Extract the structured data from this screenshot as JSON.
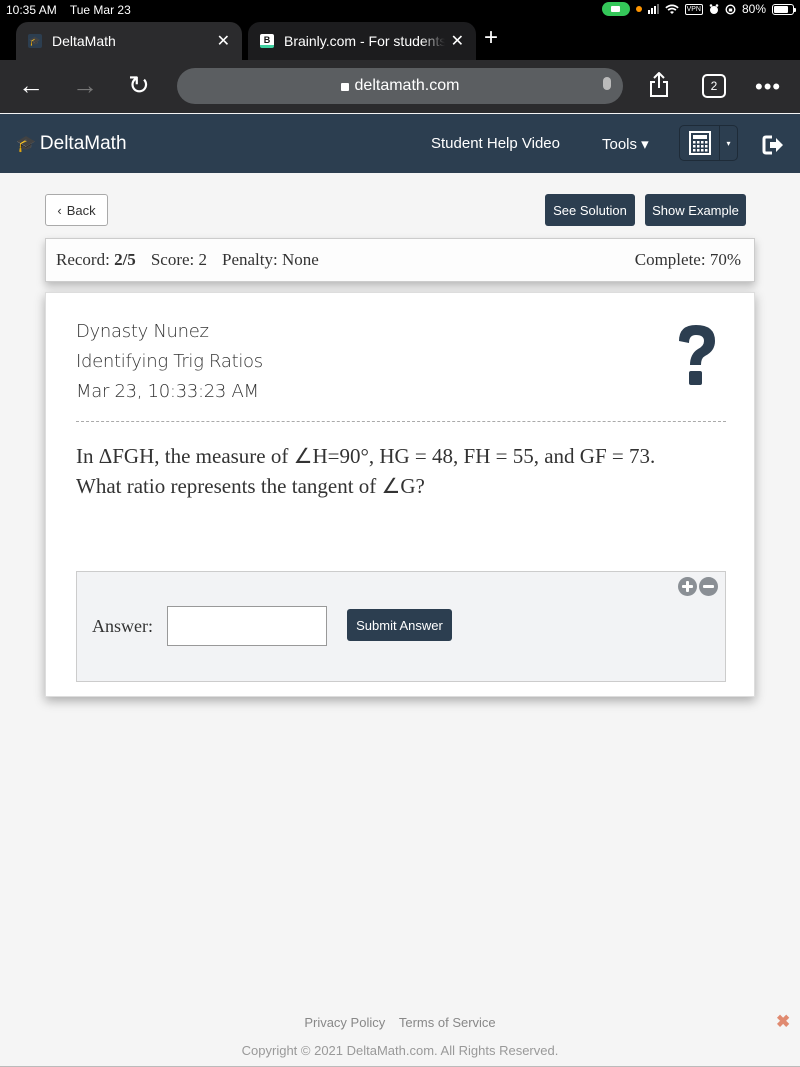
{
  "status_bar": {
    "time": "10:35 AM",
    "date": "Tue Mar 23",
    "vpn_label": "VPN",
    "battery_percent": "80%",
    "battery_level": 0.8
  },
  "browser": {
    "tabs": [
      {
        "title": "DeltaMath",
        "favicon": "graduation-cap-icon",
        "active": true
      },
      {
        "title": "Brainly.com - For students. By students.",
        "favicon": "brainly-b-icon",
        "active": false
      }
    ],
    "tab_close_glyph": "✕",
    "new_tab_glyph": "+",
    "url": "deltamath.com",
    "tab_count": "2",
    "more_glyph": "•••",
    "back_glyph": "←",
    "forward_glyph": "→",
    "reload_glyph": "↻"
  },
  "header": {
    "logo": "DeltaMath",
    "help_video": "Student Help Video",
    "tools": "Tools ▾",
    "calc_caret": "▾",
    "brand_color": "#2c3e50"
  },
  "toolbar": {
    "back": "Back",
    "see_solution": "See Solution",
    "show_example": "Show Example"
  },
  "record": {
    "record_label": "Record:",
    "record_value": "2/5",
    "score_label": "Score:",
    "score_value": "2",
    "penalty_label": "Penalty:",
    "penalty_value": "None",
    "complete_label": "Complete:",
    "complete_value": "70%"
  },
  "problem": {
    "student_name": "Dynasty Nunez",
    "topic": "Identifying Trig Ratios",
    "timestamp": "Mar 23, 10:33:23 AM",
    "question_line1": "In ΔFGH, the measure of ∠H=90°, HG = 48, FH = 55, and GF = 73.",
    "question_line2": "What ratio represents the tangent of ∠G?"
  },
  "answer": {
    "label": "Answer:",
    "value": "",
    "placeholder": "",
    "submit": "Submit Answer"
  },
  "footer": {
    "privacy": "Privacy Policy",
    "terms": "Terms of Service",
    "copyright": "Copyright © 2021 DeltaMath.com. All Rights Reserved.",
    "close_glyph": "✖",
    "close_color": "#e08a70"
  }
}
